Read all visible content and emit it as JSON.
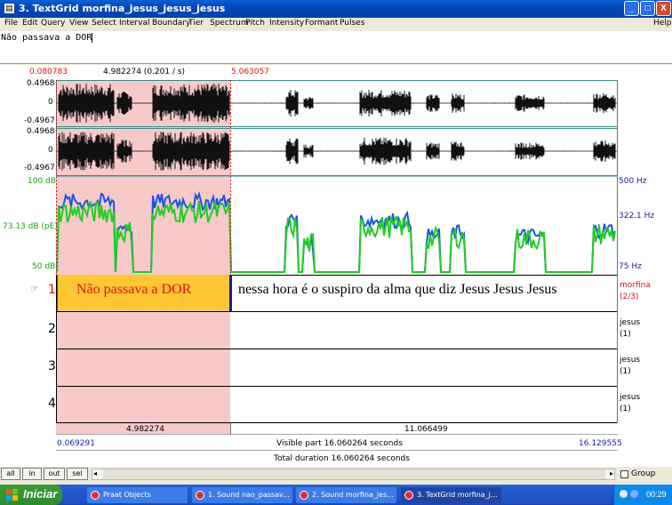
{
  "window": {
    "title": "3. TextGrid morfina_jesus_jesus_jesus",
    "buttons": {
      "minimize": "_",
      "maximize": "□",
      "close": "X"
    }
  },
  "menu": [
    "File",
    "Edit",
    "Query",
    "View",
    "Select",
    "Interval",
    "Boundary",
    "Tier",
    "Spectrum",
    "Pitch",
    "Intensity",
    "Formant",
    "Pulses"
  ],
  "help": "Help",
  "text_field": {
    "value": "Não passava a DOR"
  },
  "editor": {
    "cursor_left_time": "0.080783",
    "selection_label": "4.982274 (0.201 / s)",
    "cursor_right_time": "5.063057",
    "wave1": {
      "max": "0.4968",
      "zero": "0",
      "min": "-0.4967"
    },
    "wave2": {
      "max": "0.4968",
      "zero": "0",
      "min": "-0.4967"
    },
    "intensity": {
      "max": "100 dB",
      "current": "73.13 dB (pE)",
      "min": "50 dB"
    },
    "pitch": {
      "max": "500 Hz",
      "current": "322.1 Hz",
      "min": "75 Hz"
    },
    "selected_duration": "4.982274",
    "remaining_duration": "11.066499",
    "visible_start": "0.069291",
    "visible_part": "Visible part 16.060264 seconds",
    "visible_end": "16.129555",
    "total_duration": "Total duration 16.060264 seconds"
  },
  "tiers": [
    {
      "number": "1",
      "name": "morfina",
      "info": "(2/3)",
      "intervals": [
        "Não passava a DOR",
        "nessa hora é o suspiro da alma que diz Jesus Jesus Jesus"
      ]
    },
    {
      "number": "2",
      "name": "jesus",
      "info": "(1)"
    },
    {
      "number": "3",
      "name": "jesus",
      "info": "(1)"
    },
    {
      "number": "4",
      "name": "jesus",
      "info": "(1)"
    }
  ],
  "tier_pointer_icon": "hand-pointer-icon",
  "zoom_buttons": [
    "all",
    "in",
    "out",
    "sel"
  ],
  "group": "Group",
  "taskbar": {
    "start": "Iniciar",
    "items": [
      "Praat Objects",
      "1. Sound nao_passav...",
      "2. Sound morfina_jes...",
      "3. TextGrid morfina_j..."
    ],
    "clock": "00:29"
  },
  "colors": {
    "selection": "#f7c9c9",
    "interval_highlight": "#ffc733",
    "intensity_curve": "#22cc22",
    "pitch_curve": "#1a55e0",
    "cursor": "#d11111",
    "title_bar": "#0a5fd8"
  }
}
